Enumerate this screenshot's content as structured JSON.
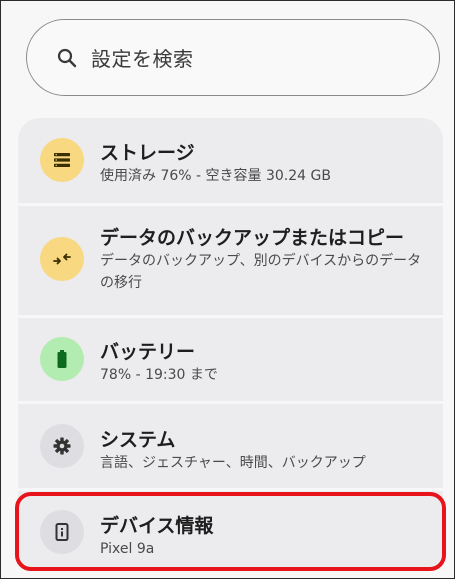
{
  "search": {
    "placeholder": "設定を検索",
    "icon": "search-icon"
  },
  "items": [
    {
      "title": "ストレージ",
      "subtitle": "使用済み 76% - 空き容量 30.24 GB",
      "icon": "storage-icon",
      "icon_bg": "#f8d880",
      "icon_color": "#3b2f00"
    },
    {
      "title": "データのバックアップまたはコピー",
      "subtitle": "データのバックアップ、別のデバイスからのデータの移行",
      "icon": "backup-transfer-icon",
      "icon_bg": "#f8d880",
      "icon_color": "#3b2f00"
    },
    {
      "title": "バッテリー",
      "subtitle": "78% - 19:30 まで",
      "icon": "battery-icon",
      "icon_bg": "#b3ecb0",
      "icon_color": "#0e6a1e"
    },
    {
      "title": "システム",
      "subtitle": "言語、ジェスチャー、時間、バックアップ",
      "icon": "gear-icon",
      "icon_bg": "#dedee2",
      "icon_color": "#333333"
    },
    {
      "title": "デバイス情報",
      "subtitle": "Pixel 9a",
      "icon": "device-info-icon",
      "icon_bg": "#dedee2",
      "icon_color": "#333333"
    }
  ],
  "colors": {
    "highlight": "#e8141c",
    "card_bg": "#ececef",
    "page_bg": "#f7f7f8"
  }
}
